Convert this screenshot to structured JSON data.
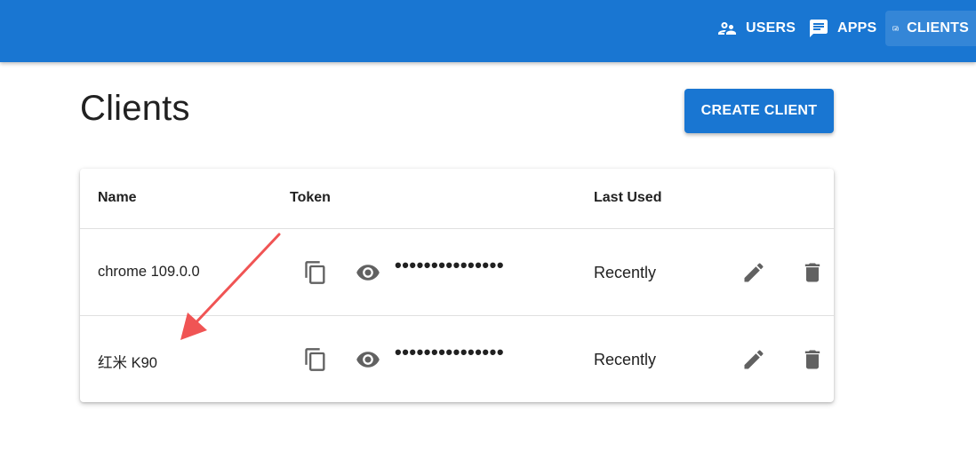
{
  "nav": {
    "users_label": "USERS",
    "apps_label": "APPS",
    "clients_label": "CLIENTS",
    "active": "clients"
  },
  "page": {
    "title": "Clients",
    "create_button_label": "CREATE CLIENT"
  },
  "table": {
    "headers": {
      "name": "Name",
      "token": "Token",
      "last_used": "Last Used"
    },
    "rows": [
      {
        "name": "chrome 109.0.0",
        "token_masked": "•••••••••••••••",
        "last_used": "Recently"
      },
      {
        "name": "红米 K90",
        "token_masked": "•••••••••••••••",
        "last_used": "Recently"
      }
    ]
  },
  "icons": {
    "users": "users-icon",
    "apps": "chat-message-icon",
    "clients": "devices-icon",
    "copy": "copy-icon",
    "visibility": "eye-icon",
    "edit": "pencil-icon",
    "delete": "trash-icon"
  },
  "colors": {
    "primary": "#1976d2",
    "icon": "#616161",
    "annotation_arrow": "#f05454"
  }
}
